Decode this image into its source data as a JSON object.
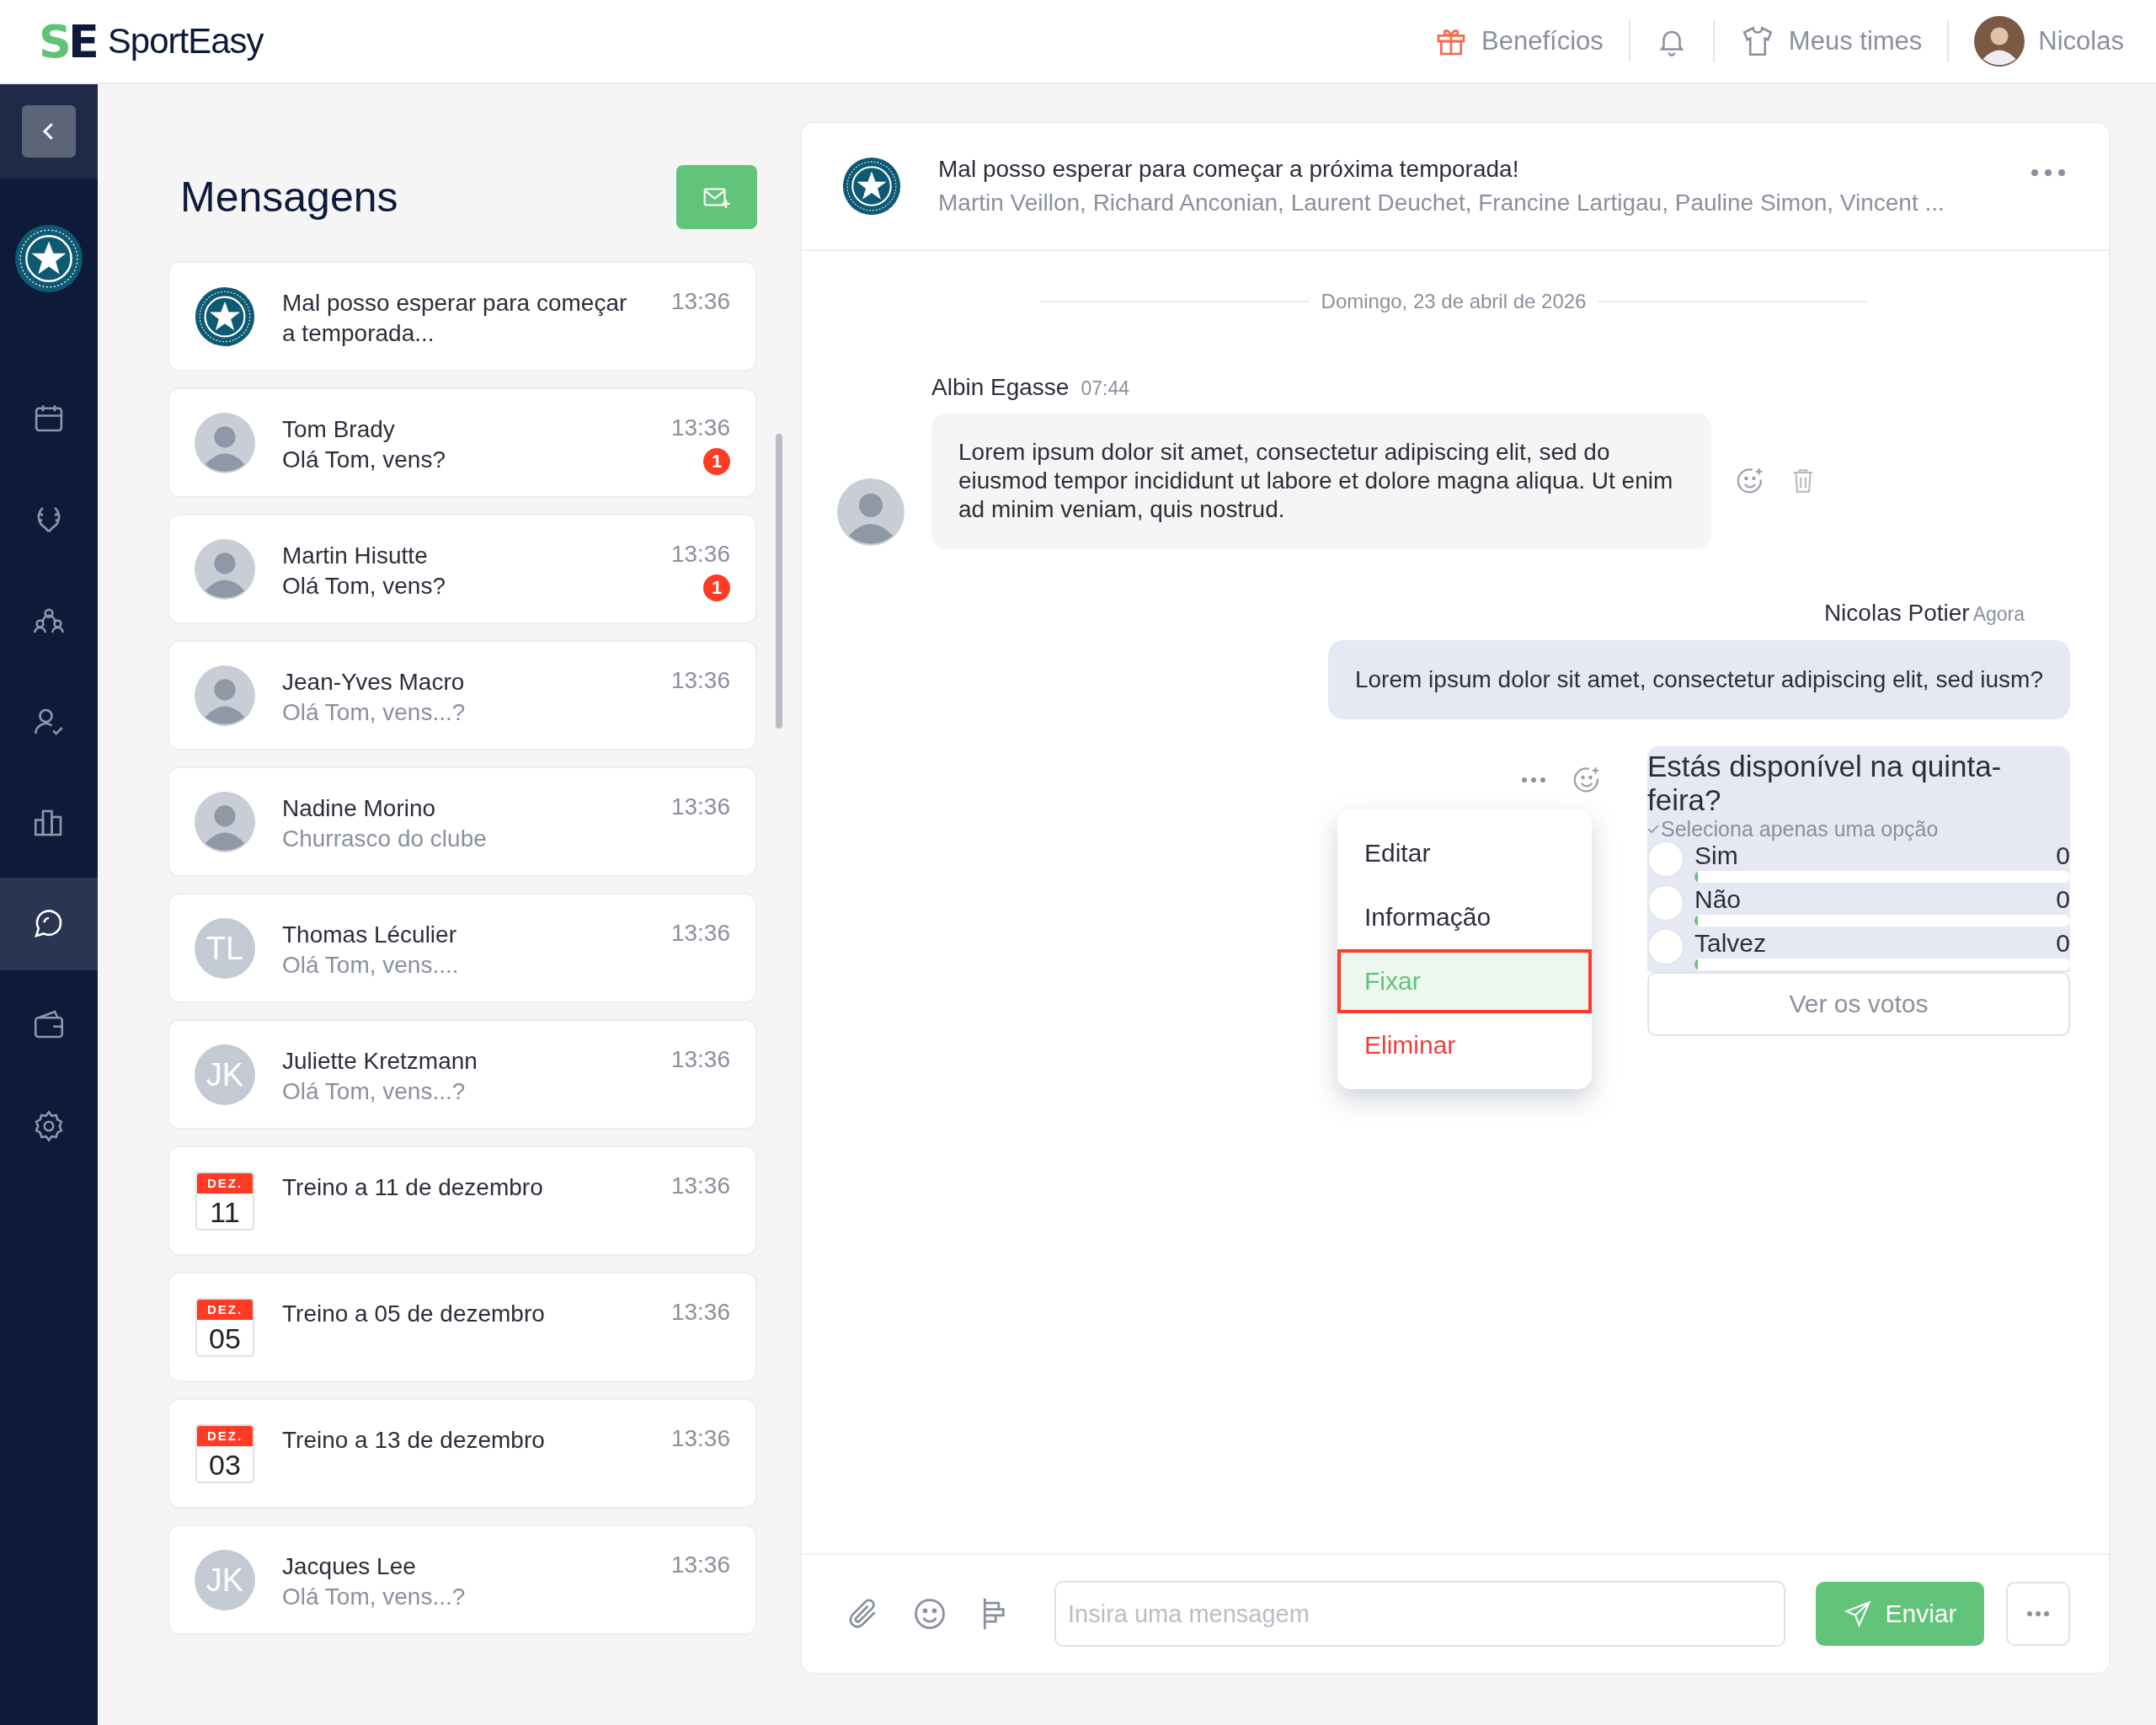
{
  "header": {
    "logo": {
      "mark": "SE",
      "name": "SportEasy"
    },
    "links": [
      {
        "kind": "gift",
        "label": "Benefícios"
      },
      {
        "kind": "bell"
      },
      {
        "kind": "shirt",
        "label": "Meus times"
      },
      {
        "kind": "user",
        "label": "Nicolas"
      }
    ]
  },
  "sidebar": {
    "items": [
      {
        "selected": false
      },
      {
        "selected": false
      },
      {
        "selected": false
      },
      {
        "selected": false
      },
      {
        "selected": false
      },
      {
        "selected": true
      },
      {
        "selected": false
      },
      {
        "selected": false
      }
    ]
  },
  "messages_panel": {
    "title": "Mensagens",
    "conversations": [
      {
        "kind": "team",
        "title": "Mal posso esperar para começar a temporada...",
        "time": "13:36"
      },
      {
        "kind": "person",
        "title": "Tom Brady",
        "preview": "Olá Tom, vens?",
        "time": "13:36",
        "muted": false,
        "badge": "1"
      },
      {
        "kind": "person",
        "title": "Martin Hisutte",
        "preview": "Olá Tom, vens?",
        "time": "13:36",
        "muted": false,
        "badge": "1"
      },
      {
        "kind": "person",
        "title": "Jean-Yves Macro",
        "preview": "Olá Tom, vens...?",
        "time": "13:36",
        "muted": true
      },
      {
        "kind": "person",
        "title": "Nadine Morino",
        "preview": "Churrasco do clube",
        "time": "13:36",
        "muted": true
      },
      {
        "kind": "initials",
        "initials": "TL",
        "title": "Thomas Léculier",
        "preview": "Olá Tom, vens....",
        "time": "13:36",
        "muted": true
      },
      {
        "kind": "initials",
        "initials": "JK",
        "title": "Juliette Kretzmann",
        "preview": "Olá Tom, vens...?",
        "time": "13:36",
        "muted": true
      },
      {
        "kind": "event",
        "month": "DEZ.",
        "day": "11",
        "title": "Treino a 11 de dezembro",
        "time": "13:36"
      },
      {
        "kind": "event",
        "month": "DEZ.",
        "day": "05",
        "title": "Treino a 05 de dezembro",
        "time": "13:36"
      },
      {
        "kind": "event",
        "month": "DEZ.",
        "day": "03",
        "title": "Treino a 13 de dezembro",
        "time": "13:36"
      },
      {
        "kind": "initials",
        "initials": "JK",
        "title": "Jacques Lee",
        "preview": "Olá Tom, vens...?",
        "time": "13:36",
        "muted": true
      }
    ]
  },
  "chat": {
    "title": "Mal posso esperar para começar a próxima temporada!",
    "members": "Martin Veillon, Richard Anconian, Laurent Deuchet, Francine Lartigau, Pauline Simon, Vincent ...",
    "date": "Domingo, 23 de abril de 2026",
    "messages": [
      {
        "kind": "incoming",
        "author": "Albin Egasse",
        "time": "07:44",
        "text": "Lorem ipsum dolor sit amet, consectetur adipiscing elit, sed do eiusmod tempor incididunt ut labore et dolore magna aliqua. Ut enim ad minim veniam, quis nostrud."
      },
      {
        "kind": "outgoing",
        "author": "Nicolas Potier",
        "time": "Agora",
        "text": "Lorem ipsum dolor sit amet, consectetur adipiscing elit, sed iusm?"
      }
    ],
    "poll": {
      "question": "Estás disponível na quinta-feira?",
      "hint": "Seleciona apenas uma opção",
      "options": [
        {
          "label": "Sim",
          "count": "0",
          "level": 0,
          "selected": false
        },
        {
          "label": "Não",
          "count": "0",
          "level": 0,
          "selected": false
        },
        {
          "label": "Talvez",
          "count": "0",
          "level": 0,
          "selected": false
        }
      ],
      "button": "Ver os votos"
    },
    "menu": [
      {
        "label": "Editar",
        "kind": "normal",
        "selected": false
      },
      {
        "label": "Informação",
        "kind": "normal",
        "selected": false
      },
      {
        "label": "Fixar",
        "kind": "normal",
        "selected": true
      },
      {
        "label": "Eliminar",
        "kind": "danger",
        "selected": false
      }
    ],
    "composer": {
      "placeholder": "Insira uma mensagem",
      "send": "Enviar"
    }
  }
}
